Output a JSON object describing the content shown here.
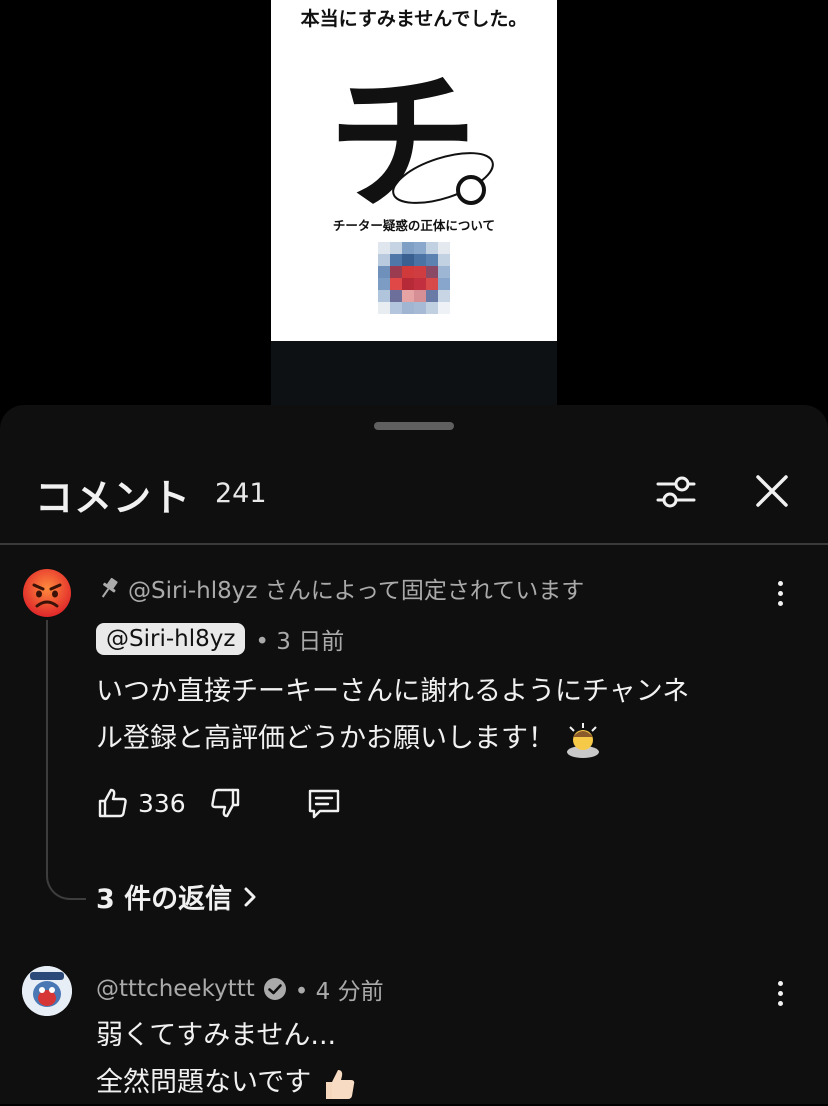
{
  "video": {
    "thumbnail_title": "本当にすみませんでした。",
    "logo_char": "チ",
    "thumbnail_caption": "チーター疑惑の正体について"
  },
  "comments_panel": {
    "title": "コメント",
    "count": "241",
    "pinned_comment": {
      "pinned_label": "@Siri-hl8yz さんによって固定されています",
      "author": "@Siri-hl8yz",
      "time": "• 3 日前",
      "text_line1": "いつか直接チーキーさんに謝れるようにチャンネ",
      "text_line2": "ル登録と高評価どうかお願いします！",
      "likes": "336",
      "replies_label": "3 件の返信",
      "avatar_icon": "angry-face-icon"
    },
    "second_comment": {
      "author": "@tttcheekyttt",
      "time": "• 4 分前",
      "text_line1": "弱くてすみません...",
      "text_line2": "全然問題ないです",
      "verified_icon": "verified-check-icon"
    }
  },
  "colors": {
    "sheet_bg": "#0f0f0f",
    "secondary_text": "#aaaaaa",
    "primary_text": "#f1f1f1"
  }
}
